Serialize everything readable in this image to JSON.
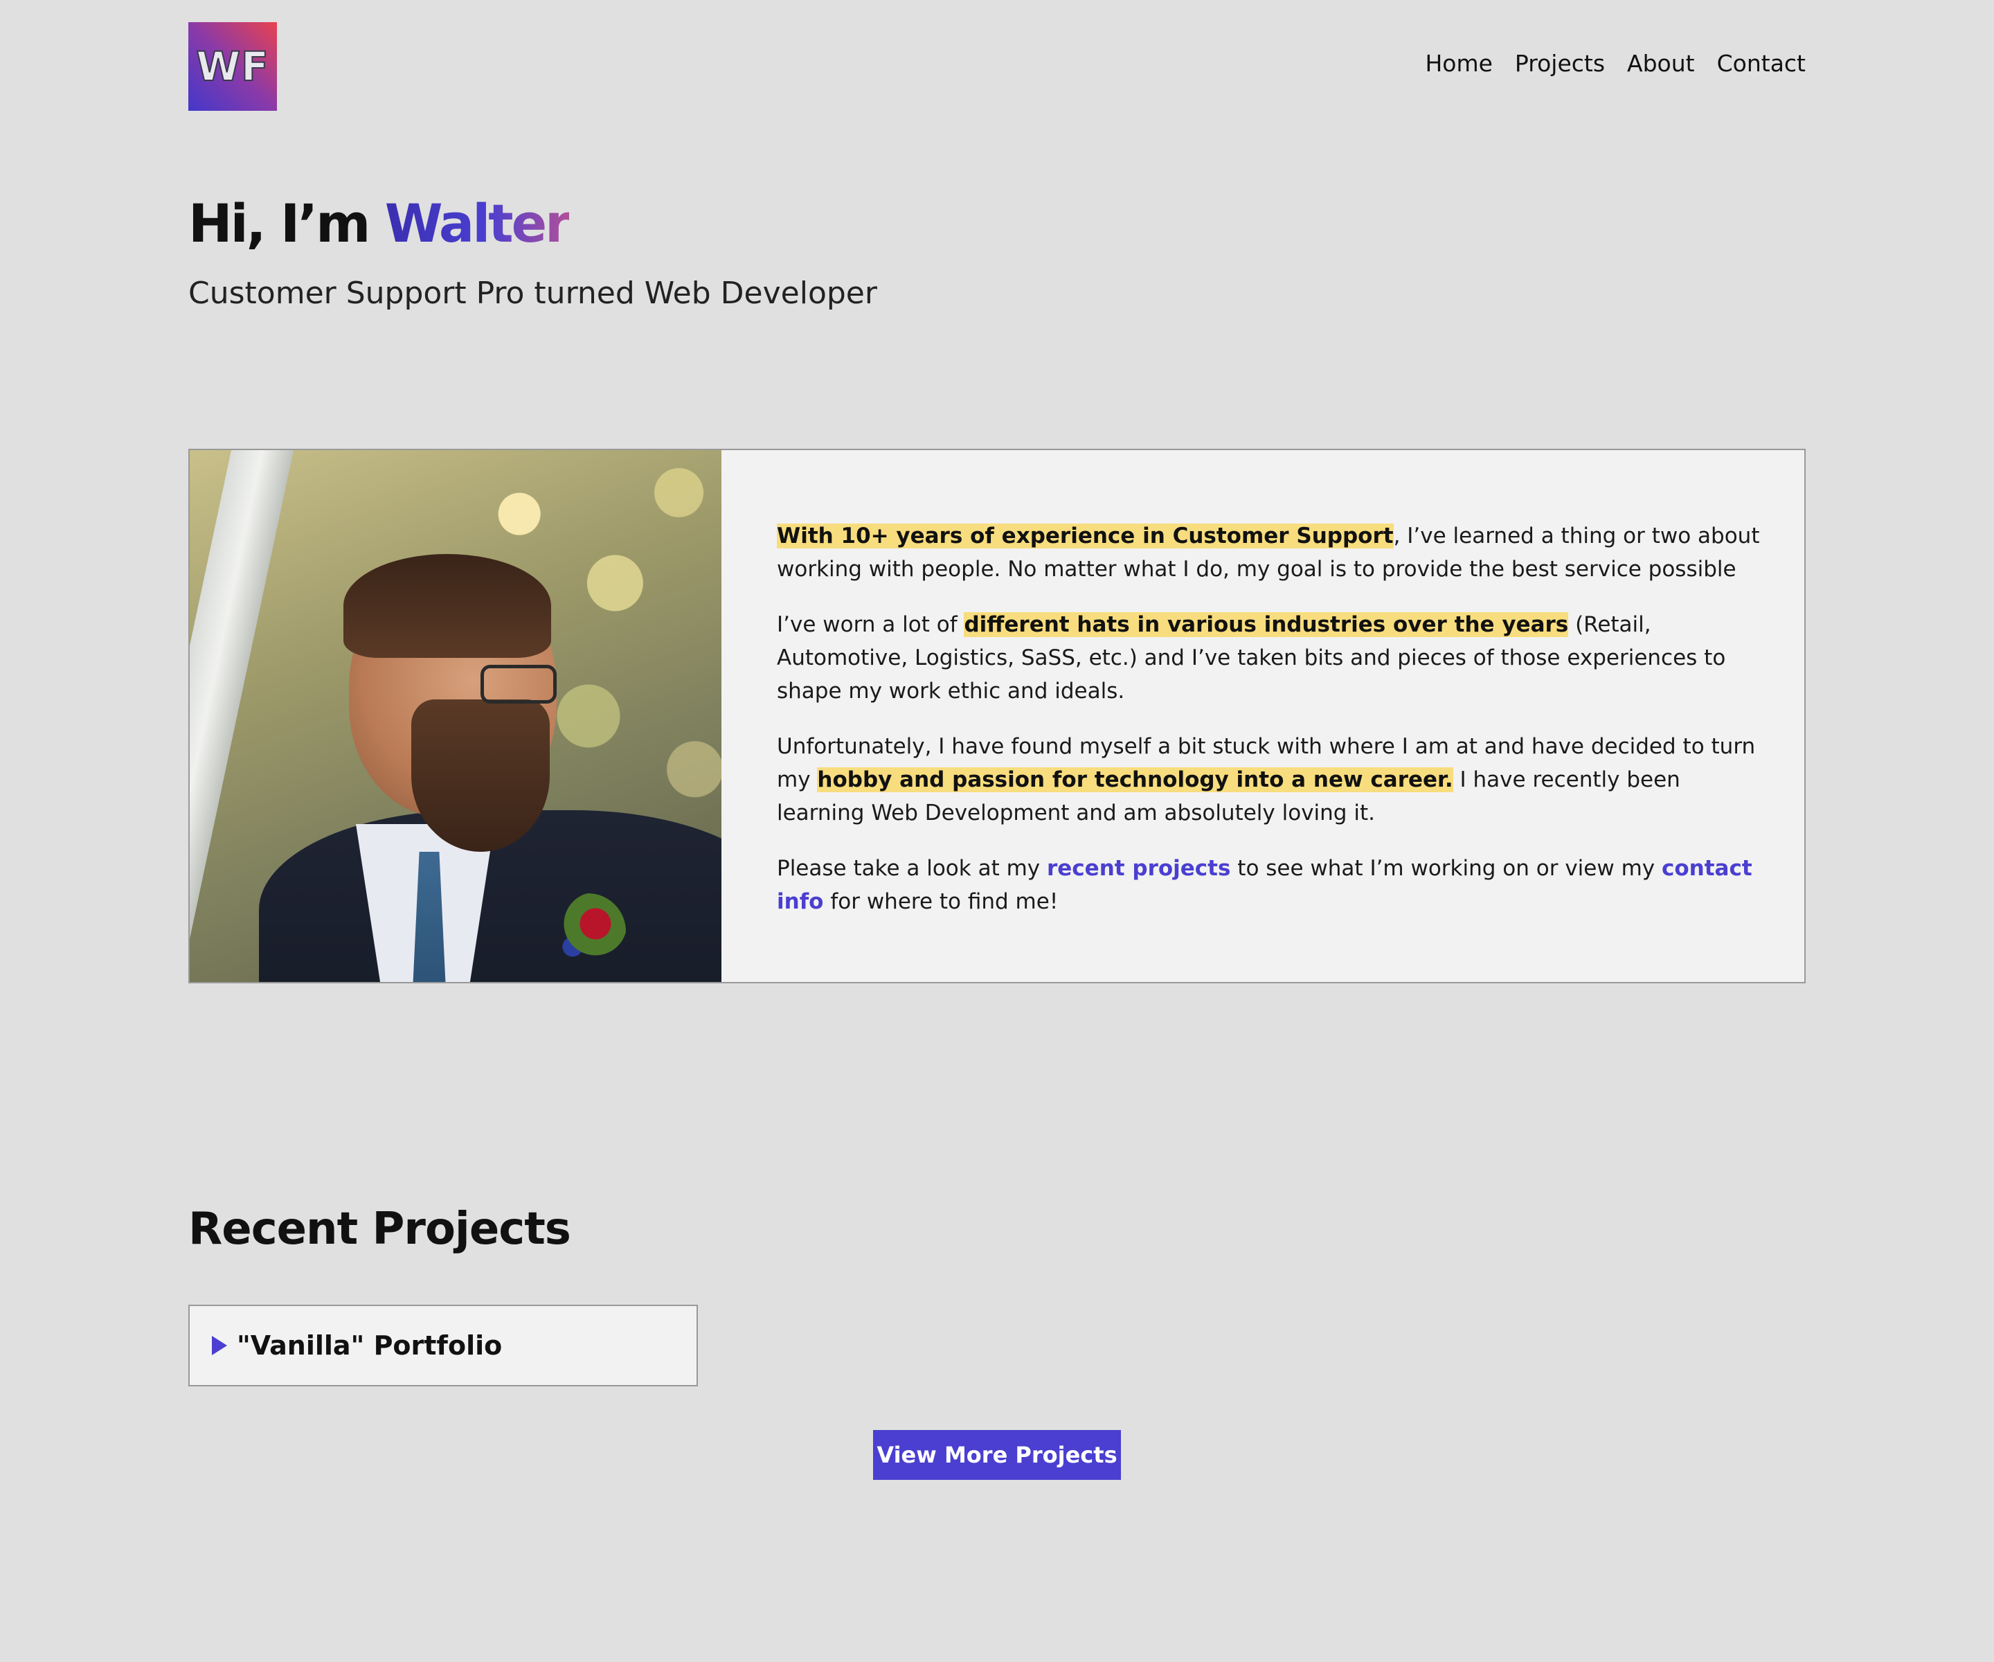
{
  "header": {
    "logo_text": "WF",
    "nav": [
      {
        "label": "Home"
      },
      {
        "label": "Projects"
      },
      {
        "label": "About"
      },
      {
        "label": "Contact"
      }
    ]
  },
  "hero": {
    "greeting": "Hi, I’m ",
    "name": "Walter",
    "subtitle": "Customer Support Pro turned Web Developer"
  },
  "about": {
    "p1": {
      "highlight": "With 10+ years of experience in Customer Support",
      "rest": ", I’ve learned a thing or two about working with people. No matter what I do, my goal is to provide the best service possible"
    },
    "p2": {
      "before": "I’ve worn a lot of ",
      "highlight": "different hats in various industries over the years",
      "after": " (Retail, Automotive, Logistics, SaSS, etc.) and I’ve taken bits and pieces of those experiences to shape my work ethic and ideals."
    },
    "p3": {
      "before": "Unfortunately, I have found myself a bit stuck with where I am at and have decided to turn my ",
      "highlight": "hobby and passion for technology into a new career.",
      "after": " I have recently been learning Web Development and am absolutely loving it."
    },
    "p4": {
      "before": "Please take a look at my ",
      "link1": "recent projects",
      "middle": " to see what I’m working on or view my ",
      "link2": "contact info",
      "after": " for where to find me!"
    }
  },
  "projects": {
    "title": "Recent Projects",
    "items": [
      {
        "label": "\"Vanilla\" Portfolio"
      }
    ],
    "more_button": "View More Projects"
  },
  "colors": {
    "accent": "#4a3fd0",
    "highlight": "#f8dd7e",
    "background": "#e0e0e0",
    "card": "#f2f2f2"
  }
}
